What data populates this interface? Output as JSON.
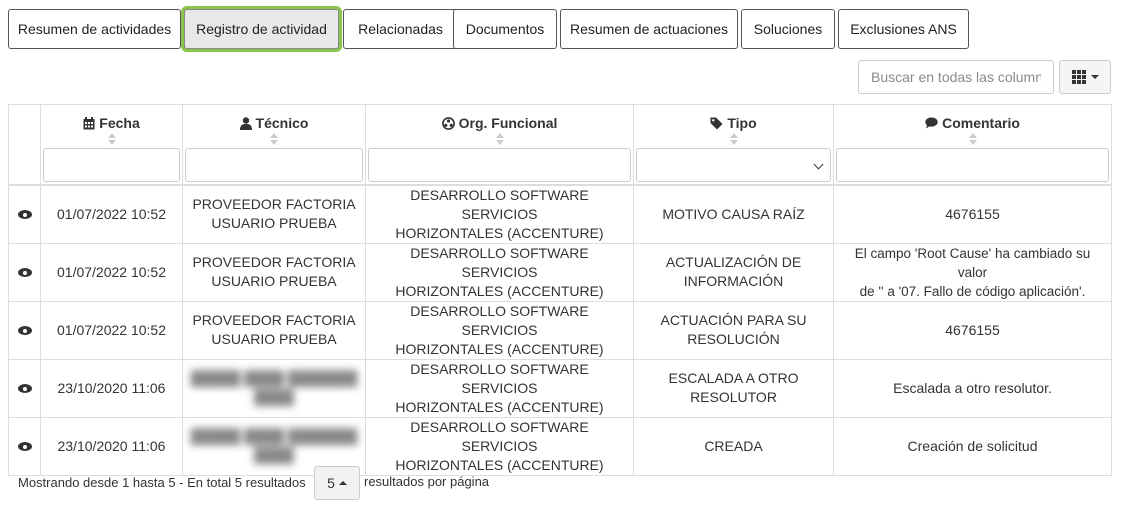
{
  "tabs": [
    {
      "label": "Resumen de actividades",
      "active": false
    },
    {
      "label": "Registro de actividad",
      "active": true
    },
    {
      "label": "Relacionadas",
      "active": false
    },
    {
      "label": "Documentos",
      "active": false
    },
    {
      "label": "Resumen de actuaciones",
      "active": false
    },
    {
      "label": "Soluciones",
      "active": false
    },
    {
      "label": "Exclusiones ANS",
      "active": false
    }
  ],
  "search": {
    "placeholder": "Buscar en todas las columnas",
    "value": ""
  },
  "columns_button": {
    "icon": "grid-icon"
  },
  "table": {
    "columns": [
      {
        "label": "Fecha",
        "icon": "calendar-icon"
      },
      {
        "label": "Técnico",
        "icon": "user-icon"
      },
      {
        "label": "Org. Funcional",
        "icon": "org-icon"
      },
      {
        "label": "Tipo",
        "icon": "tag-icon"
      },
      {
        "label": "Comentario",
        "icon": "comment-icon"
      }
    ],
    "rows": [
      {
        "fecha": "01/07/2022 10:52",
        "tecnico_l1": "PROVEEDOR FACTORIA",
        "tecnico_l2": "USUARIO PRUEBA",
        "org_l1": "DESARROLLO SOFTWARE SERVICIOS",
        "org_l2": "HORIZONTALES (ACCENTURE)",
        "tipo_l1": "MOTIVO CAUSA RAÍZ",
        "tipo_l2": "",
        "comentario_l1": "4676155",
        "comentario_l2": ""
      },
      {
        "fecha": "01/07/2022 10:52",
        "tecnico_l1": "PROVEEDOR FACTORIA",
        "tecnico_l2": "USUARIO PRUEBA",
        "org_l1": "DESARROLLO SOFTWARE SERVICIOS",
        "org_l2": "HORIZONTALES (ACCENTURE)",
        "tipo_l1": "ACTUALIZACIÓN DE",
        "tipo_l2": "INFORMACIÓN",
        "comentario_l1": "El campo 'Root Cause' ha cambiado su valor",
        "comentario_l2": "de '' a '07. Fallo de código aplicación'."
      },
      {
        "fecha": "01/07/2022 10:52",
        "tecnico_l1": "PROVEEDOR FACTORIA",
        "tecnico_l2": "USUARIO PRUEBA",
        "org_l1": "DESARROLLO SOFTWARE SERVICIOS",
        "org_l2": "HORIZONTALES (ACCENTURE)",
        "tipo_l1": "ACTUACIÓN PARA SU",
        "tipo_l2": "RESOLUCIÓN",
        "comentario_l1": "4676155",
        "comentario_l2": ""
      },
      {
        "fecha": "23/10/2020 11:06",
        "tecnico_l1": "",
        "tecnico_l2": "",
        "org_l1": "DESARROLLO SOFTWARE SERVICIOS",
        "org_l2": "HORIZONTALES (ACCENTURE)",
        "tipo_l1": "ESCALADA A OTRO",
        "tipo_l2": "RESOLUTOR",
        "comentario_l1": "Escalada a otro resolutor.",
        "comentario_l2": ""
      },
      {
        "fecha": "23/10/2020 11:06",
        "tecnico_l1": "",
        "tecnico_l2": "",
        "org_l1": "DESARROLLO SOFTWARE SERVICIOS",
        "org_l2": "HORIZONTALES (ACCENTURE)",
        "tipo_l1": "CREADA",
        "tipo_l2": "",
        "comentario_l1": "Creación de solicitud",
        "comentario_l2": ""
      }
    ]
  },
  "footer": {
    "showing": "Mostrando desde 1 hasta 5 - En total 5 resultados",
    "page_size": "5",
    "per_page_label": "resultados por página"
  },
  "colors": {
    "active_tab_glow": "#8cc34a",
    "border": "#dddddd"
  }
}
